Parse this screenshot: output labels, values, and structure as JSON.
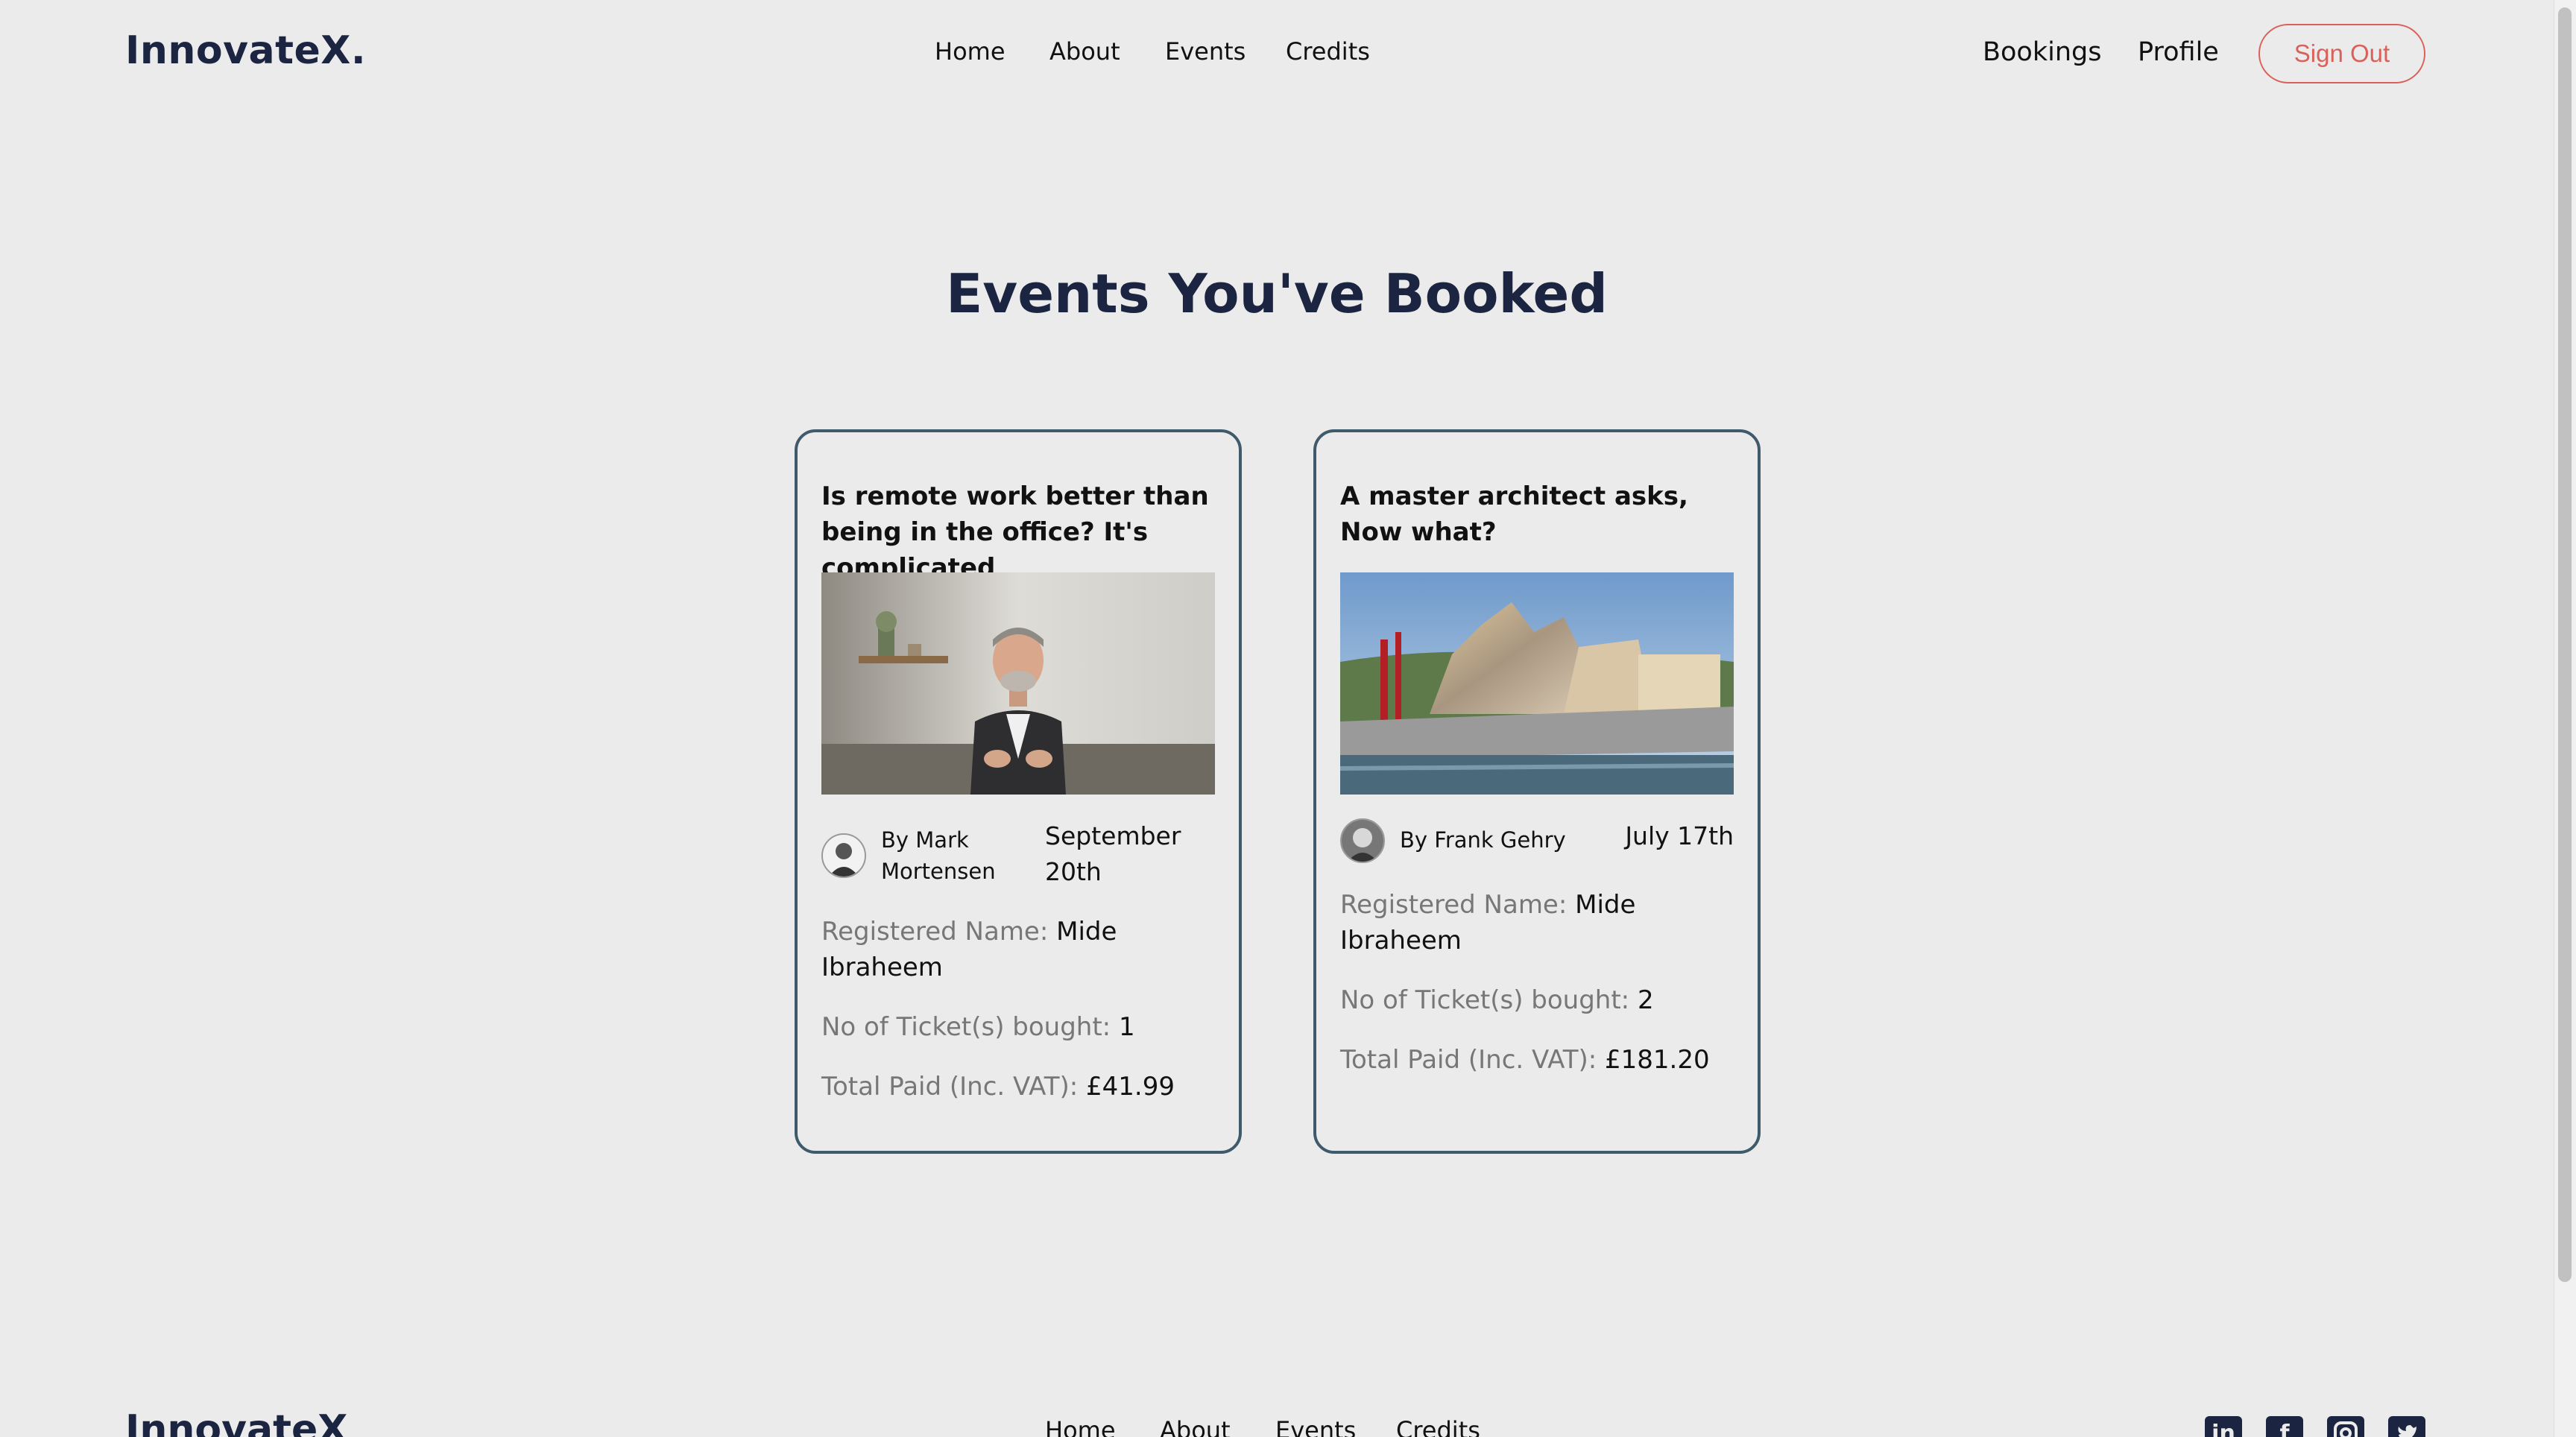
{
  "header": {
    "brand": "InnovateX.",
    "nav": [
      "Home",
      "About",
      "Events",
      "Credits"
    ],
    "right_nav": [
      "Bookings",
      "Profile"
    ],
    "sign_out": "Sign Out"
  },
  "main": {
    "title": "Events You've Booked",
    "bookings": [
      {
        "title": "Is remote work better than being in the office? It's complicated",
        "speaker": "By Mark Mortensen",
        "date": "September 20th",
        "registered_label": "Registered Name:",
        "registered_name": "Mide Ibraheem",
        "tickets_label": "No of Ticket(s) bought:",
        "tickets": "1",
        "total_label": "Total Paid (Inc. VAT):",
        "total": "£41.99"
      },
      {
        "title": "A master architect asks, Now what?",
        "speaker": "By Frank Gehry",
        "date": "July 17th",
        "registered_label": "Registered Name:",
        "registered_name": "Mide Ibraheem",
        "tickets_label": "No of Ticket(s) bought:",
        "tickets": "2",
        "total_label": "Total Paid (Inc. VAT):",
        "total": "£181.20"
      }
    ]
  },
  "footer": {
    "brand": "InnovateX",
    "nav": [
      "Home",
      "About",
      "Events",
      "Credits"
    ],
    "social": [
      "linkedin-icon",
      "facebook-icon",
      "instagram-icon",
      "twitter-icon"
    ]
  },
  "colors": {
    "brand": "#1b2541",
    "accent": "#d9615a",
    "card_border": "#3f5a6a",
    "background": "#ebebeb"
  }
}
